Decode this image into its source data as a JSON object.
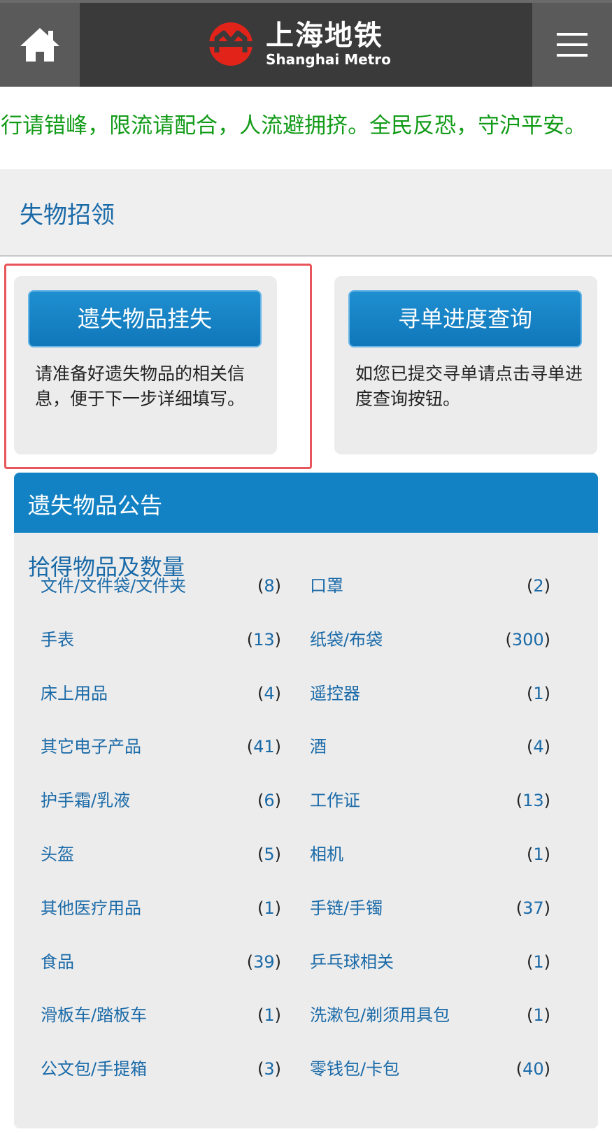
{
  "header": {
    "home_icon": "home-icon",
    "menu_icon": "hamburger-menu-icon",
    "logo_cn": "上海地铁",
    "logo_en": "Shanghai Metro"
  },
  "ticker": {
    "text": "J行请错峰，限流请配合，人流避拥挤。全民反恐，守沪平安。"
  },
  "section_title": "失物招领",
  "cards": [
    {
      "button": "遗失物品挂失",
      "desc": "请准备好遗失物品的相关信息，便于下一步详细填写。"
    },
    {
      "button": "寻单进度查询",
      "desc": "如您已提交寻单请点击寻单进度查询按钮。"
    }
  ],
  "notice": {
    "title": "遗失物品公告",
    "subtitle": "拾得物品及数量",
    "left_items": [
      {
        "name": "文件/文件袋/文件夹",
        "count": "8"
      },
      {
        "name": "手表",
        "count": "13"
      },
      {
        "name": "床上用品",
        "count": "4"
      },
      {
        "name": "其它电子产品",
        "count": "41"
      },
      {
        "name": "护手霜/乳液",
        "count": "6"
      },
      {
        "name": "头盔",
        "count": "5"
      },
      {
        "name": "其他医疗用品",
        "count": "1"
      },
      {
        "name": "食品",
        "count": "39"
      },
      {
        "name": "滑板车/踏板车",
        "count": "1"
      },
      {
        "name": "公文包/手提箱",
        "count": "3"
      }
    ],
    "right_items": [
      {
        "name": "口罩",
        "count": "2"
      },
      {
        "name": "纸袋/布袋",
        "count": "300"
      },
      {
        "name": "遥控器",
        "count": "1"
      },
      {
        "name": "酒",
        "count": "4"
      },
      {
        "name": "工作证",
        "count": "13"
      },
      {
        "name": "相机",
        "count": "1"
      },
      {
        "name": "手链/手镯",
        "count": "37"
      },
      {
        "name": "乒乓球相关",
        "count": "1"
      },
      {
        "name": "洗漱包/剃须用具包",
        "count": "1"
      },
      {
        "name": "零钱包/卡包",
        "count": "40"
      }
    ]
  },
  "colors": {
    "header_bg": "#3a3a3a",
    "ticker_green": "#129b18",
    "accent_blue": "#1382c4",
    "link_blue": "#1a6aa8",
    "highlight_red": "#e8555a",
    "logo_red": "#e2231a"
  }
}
